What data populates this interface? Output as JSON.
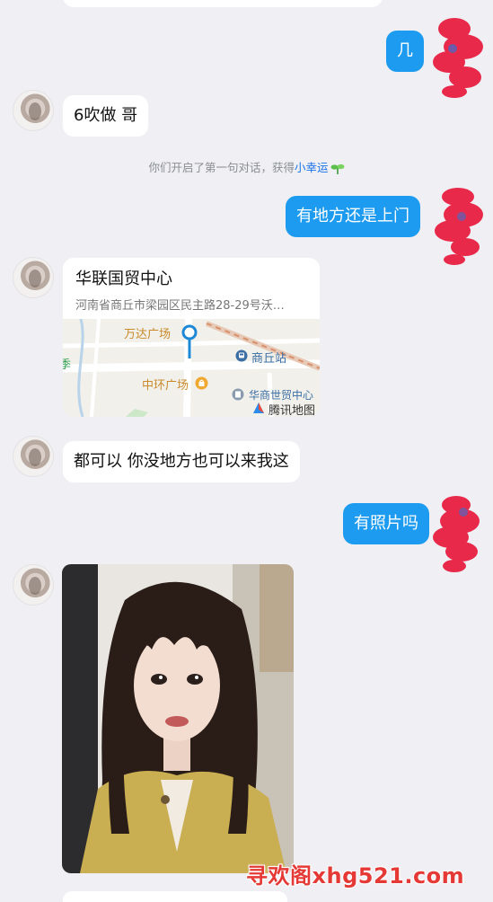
{
  "messages": {
    "m1_right": "几",
    "m2_left": "6吹做 哥",
    "system": {
      "prefix": "你们开启了第一句对话，获得",
      "highlight": "小幸运"
    },
    "m3_right": "有地方还是上门",
    "m5_left": "都可以 你没地方也可以来我这",
    "m6_right": "有照片吗"
  },
  "location": {
    "title": "华联国贸中心",
    "address": "河南省商丘市梁园区民主路28-29号沃…",
    "map_labels": {
      "wanda": "万达广场",
      "station": "商丘站",
      "zhonghuan": "中环广场",
      "huashang": "华商世贸中心",
      "tencent": "腾讯地图",
      "edge": "季"
    }
  },
  "watermark": "寻欢阁xhg521.com",
  "colors": {
    "bubble_right": "#1d9bf0",
    "bubble_left": "#ffffff",
    "background": "#efeff4",
    "watermark": "#e53935"
  }
}
